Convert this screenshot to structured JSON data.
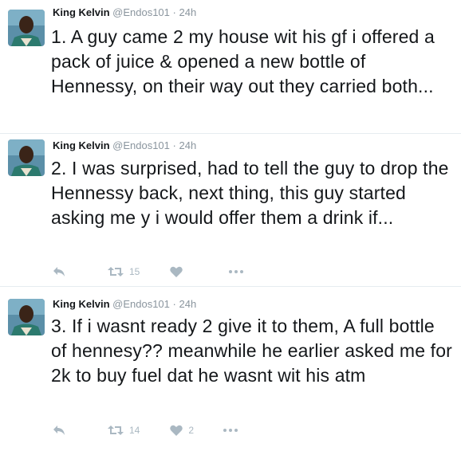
{
  "tweets": [
    {
      "name": "King Kelvin",
      "handle": "@Endos101",
      "separator": "·",
      "time": "24h",
      "text": "1. A guy came 2 my house wit his gf i offered a pack of juice & opened a new bottle of Hennessy, on their way out they carried both...",
      "show_actions": false
    },
    {
      "name": "King Kelvin",
      "handle": "@Endos101",
      "separator": "·",
      "time": "24h",
      "text": "2. I was surprised, had to tell the guy to drop the Hennessy back, next thing, this guy started asking me y i would offer them a drink if...",
      "retweets": "15",
      "likes": ""
    },
    {
      "name": "King Kelvin",
      "handle": "@Endos101",
      "separator": "·",
      "time": "24h",
      "text": "3. If i wasnt ready 2 give it to them, A full bottle of hennesy?? meanwhile he earlier asked me for 2k to buy fuel dat he wasnt wit his atm",
      "retweets": "14",
      "likes": "2"
    }
  ],
  "icons": {
    "reply": "reply-icon",
    "retweet": "retweet-icon",
    "like": "heart-icon",
    "more": "more-icon"
  },
  "colors": {
    "text": "#14171a",
    "meta": "#8a959e",
    "action": "#aab8c2",
    "divider": "#e6ecf0"
  }
}
